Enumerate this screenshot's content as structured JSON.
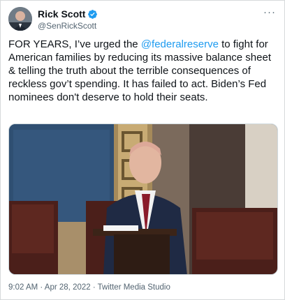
{
  "author": {
    "name": "Rick Scott",
    "handle": "@SenRickScott",
    "verified_icon": "verified-badge-icon",
    "avatar_icon": "avatar-icon"
  },
  "menu_icon": "more-options-icon",
  "tweet": {
    "text_before": "FOR YEARS, I’ve urged the ",
    "mention": "@federalreserve",
    "text_after": " to fight for American families by reducing its massive balance sheet & telling the truth about the terrible consequences of reckless gov’t spending. It has failed to act. Biden’s Fed nominees don't deserve to hold their seats."
  },
  "media": {
    "icon": "video-thumbnail"
  },
  "meta": {
    "time": "9:02 AM",
    "separator": " · ",
    "date": "Apr 28, 2022",
    "source": "Twitter Media Studio"
  },
  "colors": {
    "link": "#1d9bf0",
    "verified": "#1d9bf0",
    "text": "#0f1419",
    "muted": "#536471"
  }
}
